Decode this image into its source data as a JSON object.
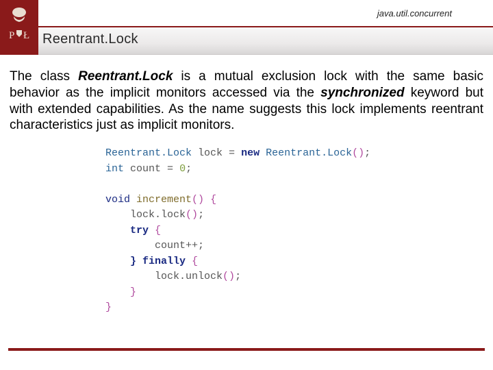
{
  "header": {
    "package": "java.util.concurrent",
    "title": "Reentrant.Lock"
  },
  "body": {
    "p1a": "The class ",
    "p1b": "Reentrant.Lock",
    "p1c": " is a mutual exclusion lock with the same basic behavior as the implicit monitors accessed via the ",
    "p1d": "synchronized",
    "p1e": " keyword but with extended capabilities. As the name suggests this lock implements reentrant characteristics just as implicit monitors."
  },
  "code": {
    "t_reentrant": "Reentrant.Lock",
    "v_lock": " lock ",
    "eq": "=",
    "sp": " ",
    "k_new": "new",
    "ctor_open": "(",
    "ctor_close": ")",
    "semi": ";",
    "t_int": "int",
    "v_count": " count ",
    "zero": "0",
    "k_void": "void",
    "m_increment": " increment",
    "brace_open": "{",
    "brace_close": "}",
    "call_lock": "    lock.lock",
    "k_try": "    try ",
    "inc_stmt": "        count++;",
    "k_finally": "    } finally ",
    "call_unlock": "        lock.unlock",
    "indent1": "    "
  }
}
